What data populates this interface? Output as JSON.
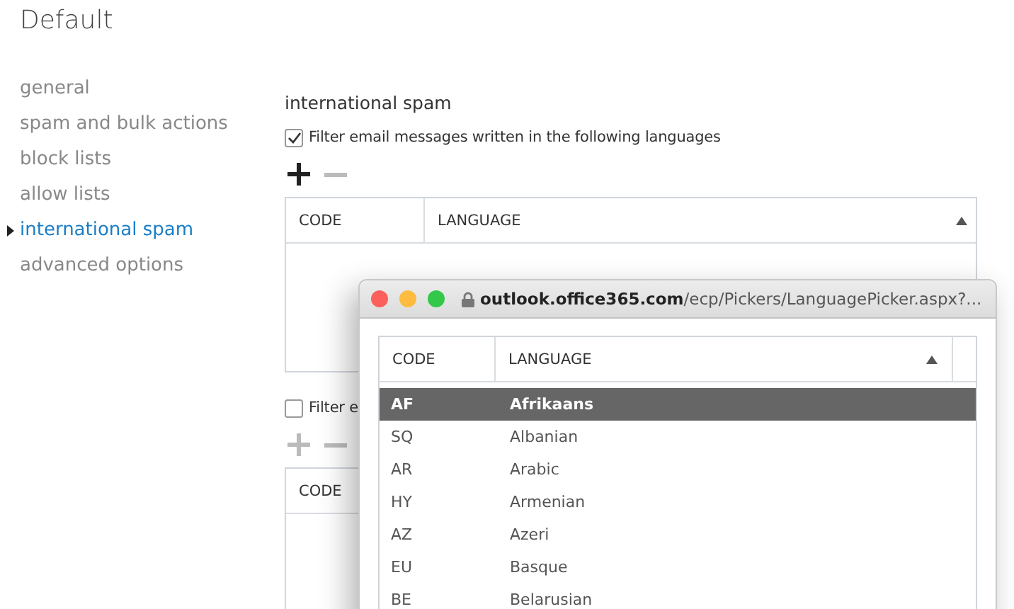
{
  "page_title": "Default",
  "sidebar": {
    "items": [
      {
        "label": "general",
        "selected": false
      },
      {
        "label": "spam and bulk actions",
        "selected": false
      },
      {
        "label": "block lists",
        "selected": false
      },
      {
        "label": "allow lists",
        "selected": false
      },
      {
        "label": "international spam",
        "selected": true
      },
      {
        "label": "advanced options",
        "selected": false
      }
    ]
  },
  "section_title": "international spam",
  "filters": [
    {
      "label": "Filter email messages written in the following languages",
      "checked": true,
      "add_disabled": false,
      "remove_disabled": true,
      "columns": [
        "CODE",
        "LANGUAGE"
      ]
    },
    {
      "label": "Filter e",
      "checked": false,
      "add_disabled": true,
      "remove_disabled": true,
      "columns": [
        "CODE"
      ]
    }
  ],
  "picker_window": {
    "address": "**outlook.office365.com**/ecp/Pickers/LanguagePicker.aspx?...",
    "columns": [
      "CODE",
      "LANGUAGE"
    ],
    "rows": [
      {
        "code": "AF",
        "language": "Afrikaans",
        "selected": true
      },
      {
        "code": "SQ",
        "language": "Albanian",
        "selected": false
      },
      {
        "code": "AR",
        "language": "Arabic",
        "selected": false
      },
      {
        "code": "HY",
        "language": "Armenian",
        "selected": false
      },
      {
        "code": "AZ",
        "language": "Azeri",
        "selected": false
      },
      {
        "code": "EU",
        "language": "Basque",
        "selected": false
      },
      {
        "code": "BE",
        "language": "Belarusian",
        "selected": false
      }
    ]
  }
}
